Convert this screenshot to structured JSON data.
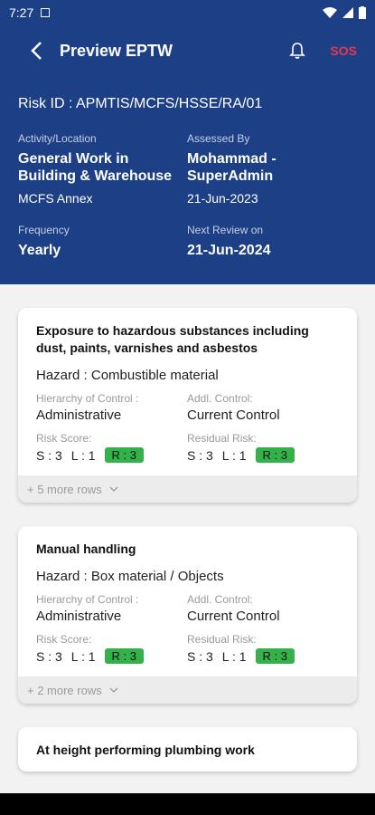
{
  "status": {
    "time": "7:27"
  },
  "appbar": {
    "title": "Preview EPTW",
    "sos": "SOS"
  },
  "header": {
    "risk_id": "Risk ID : APMTIS/MCFS/HSSE/RA/01",
    "activity_label": "Activity/Location",
    "activity_value": "General Work in Building & Warehouse",
    "activity_sub": "MCFS Annex",
    "assessed_label": "Assessed By",
    "assessed_value": "Mohammad - SuperAdmin",
    "assessed_date": "21-Jun-2023",
    "frequency_label": "Frequency",
    "frequency_value": "Yearly",
    "review_label": "Next Review on",
    "review_value": "21-Jun-2024"
  },
  "cards": [
    {
      "title": "Exposure to hazardous substances including dust, paints, varnishes and asbestos",
      "hazard": "Hazard : Combustible material",
      "hoc_label": "Hierarchy of Control :",
      "hoc_value": "Administrative",
      "addl_label": "Addl. Control:",
      "addl_value": "Current Control",
      "risk_label": "Risk Score:",
      "risk_s": "S : 3",
      "risk_l": "L : 1",
      "risk_r": "R : 3",
      "resid_label": "Residual Risk:",
      "resid_s": "S : 3",
      "resid_l": "L : 1",
      "resid_r": "R : 3",
      "more": "+ 5  more rows"
    },
    {
      "title": "Manual handling",
      "hazard": "Hazard : Box material / Objects",
      "hoc_label": "Hierarchy of Control :",
      "hoc_value": "Administrative",
      "addl_label": "Addl. Control:",
      "addl_value": "Current Control",
      "risk_label": "Risk Score:",
      "risk_s": "S : 3",
      "risk_l": "L : 1",
      "risk_r": "R : 3",
      "resid_label": "Residual Risk:",
      "resid_s": "S : 3",
      "resid_l": "L : 1",
      "resid_r": "R : 3",
      "more": "+ 2  more rows"
    },
    {
      "title": "At height performing plumbing work"
    }
  ],
  "colors": {
    "header_bg": "#1c3f85",
    "sos": "#e53950",
    "badge": "#33b24a"
  },
  "icons": [
    "back-arrow-icon",
    "bell-icon",
    "chevron-down-icon",
    "wifi-icon",
    "battery-icon"
  ]
}
